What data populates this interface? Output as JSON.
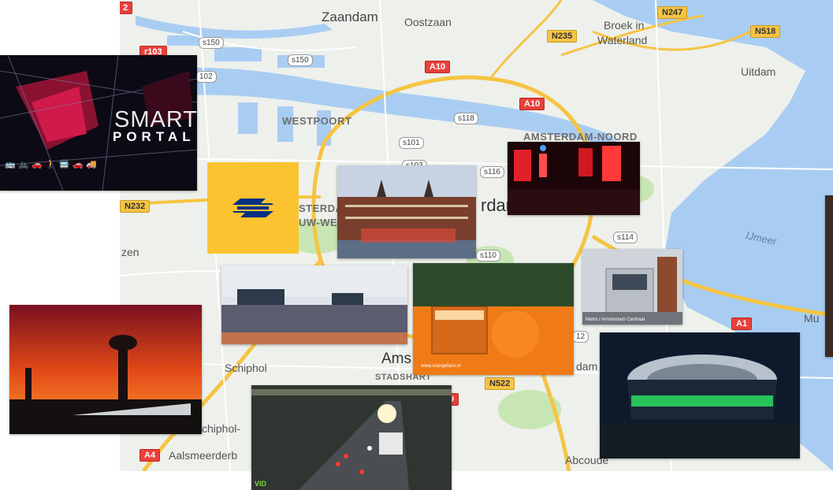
{
  "map": {
    "places": {
      "zaandam": "Zaandam",
      "oostzaan": "Oostzaan",
      "broek": "Broek in",
      "waterland": "Waterland",
      "uitdam": "Uitdam",
      "westpoort": "WESTPOORT",
      "amsterdam_noord": "AMSTERDAM-NOORD",
      "sterda": "STERDA",
      "uw_we": "UW-WE",
      "rdam_partial": "rdam",
      "zen": "zen",
      "schiphol": "Schiphol",
      "ams": "Ams",
      "stadshart": "STADSHART",
      "dam_partial": "dam",
      "schiphol_oost": "chiphol-",
      "aalsmeer": "Aalsmeerderb",
      "abcoude": "Abcoude",
      "ijmeer": "IJmeer",
      "mu": "Mu"
    },
    "roads": {
      "a10_top": "A10",
      "a10_mid": "A10",
      "a1": "A1",
      "a4": "A4",
      "n247": "N247",
      "n235": "N235",
      "n518": "N518",
      "n232": "N232",
      "n522": "N522",
      "r103": "r103",
      "n2_partial": "2",
      "s150a": "s150",
      "s150b": "s150",
      "s102": "102",
      "s118": "s118",
      "s101": "s101",
      "s103": "s103",
      "s116": "s116",
      "s114": "s114",
      "s110": "s110",
      "s112": "12",
      "s9": "9"
    }
  },
  "photos": {
    "smart_portal": {
      "title": "SMART",
      "subtitle": "PORTAL"
    },
    "ns_logo": "ns-logo",
    "football_caption": "www.orangefans.nl",
    "tram_caption": "Metro / Amsterdam Centraal",
    "traffic_badge": "VID"
  },
  "colors": {
    "water": "#a9cdf2",
    "land": "#eef0ec",
    "park": "#c8e6b4",
    "highway": "#f6c443",
    "ns_yellow": "#fbc32f",
    "ns_blue": "#003082"
  }
}
